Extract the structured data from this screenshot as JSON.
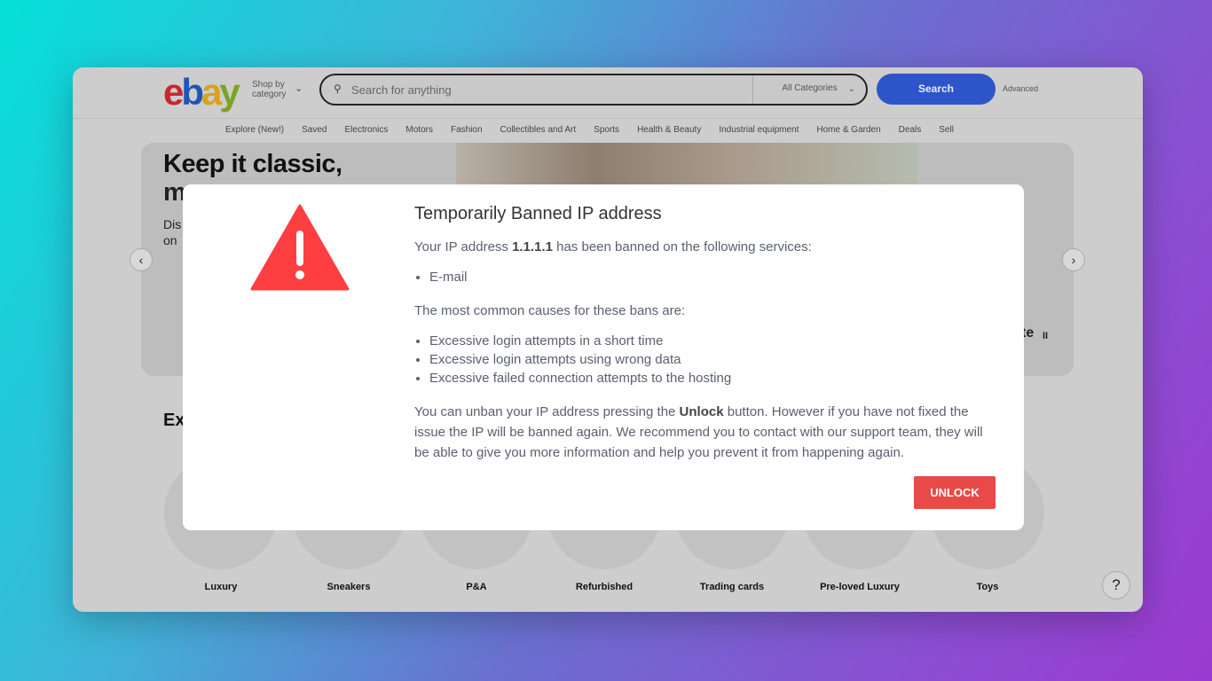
{
  "header": {
    "logo": {
      "e": "e",
      "b": "b",
      "a": "a",
      "y": "y"
    },
    "shop_by_1": "Shop by",
    "shop_by_2": "category",
    "search_placeholder": "Search for anything",
    "category": "All Categories",
    "search_button": "Search",
    "advanced": "Advanced"
  },
  "nav": [
    "Explore (New!)",
    "Saved",
    "Electronics",
    "Motors",
    "Fashion",
    "Collectibles and Art",
    "Sports",
    "Health & Beauty",
    "Industrial equipment",
    "Home & Garden",
    "Deals",
    "Sell"
  ],
  "hero": {
    "title": "Keep it classic,",
    "frag_m": "m",
    "frag_dis": "Dis",
    "frag_on": "on",
    "frag_te": "te",
    "explore_frag": "Ex"
  },
  "categories": [
    "Luxury",
    "Sneakers",
    "P&A",
    "Refurbished",
    "Trading cards",
    "Pre-loved Luxury",
    "Toys"
  ],
  "help": "?",
  "modal": {
    "title": "Temporarily Banned IP address",
    "intro_pre": "Your IP address ",
    "ip": "1.1.1.1",
    "intro_post": " has been banned on the following services:",
    "services": [
      "E-mail"
    ],
    "causes_title": "The most common causes for these bans are:",
    "causes": [
      "Excessive login attempts in a short time",
      "Excessive login attempts using wrong data",
      "Excessive failed connection attempts to the hosting"
    ],
    "note_pre": "You can unban your IP address pressing the ",
    "note_bold": "Unlock",
    "note_post": " button. However if you have not fixed the issue the IP will be banned again. We recommend you to contact with our support team, they will be able to give you more information and help you prevent it from happening again.",
    "unlock": "UNLOCK"
  },
  "colors": {
    "warning": "#fd3f41",
    "unlock": "#ea4a47",
    "search": "#2d55c9"
  }
}
